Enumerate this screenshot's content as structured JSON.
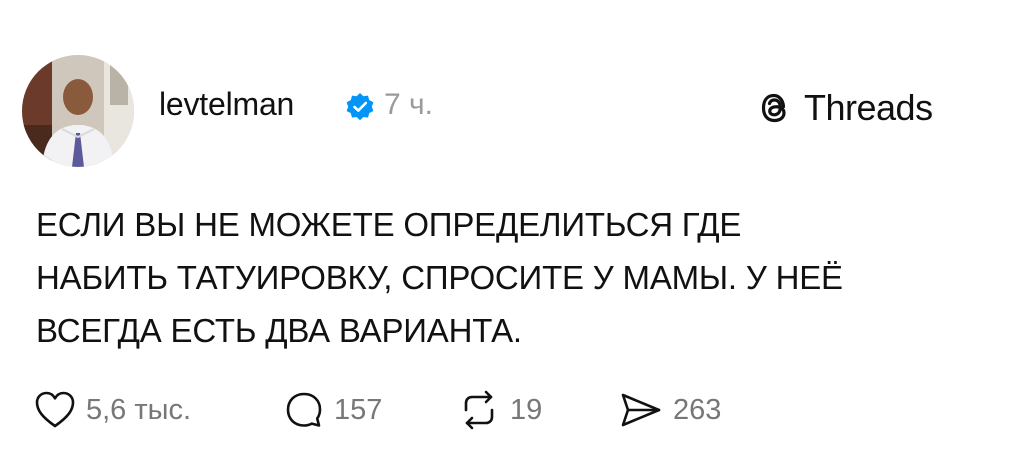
{
  "post": {
    "username": "levtelman",
    "time_ago": "7 ч.",
    "text_lines": [
      "ЕСЛИ ВЫ НЕ МОЖЕТЕ ОПРЕДЕЛИТЬСЯ ГДЕ",
      "НАБИТЬ ТАТУИРОВКУ, СПРОСИТЕ У МАМЫ. У НЕЁ",
      "ВСЕГДА ЕСТЬ ДВА ВАРИАНТА."
    ]
  },
  "brand": {
    "label": "Threads",
    "icon": "threads-logo-icon"
  },
  "actions": {
    "likes": "5,6 тыс.",
    "replies": "157",
    "reposts": "19",
    "shares": "263"
  },
  "colors": {
    "verified_badge": "#0095f6",
    "muted_text": "#777777",
    "time_text": "#9a9a9a",
    "primary_text": "#111111"
  }
}
